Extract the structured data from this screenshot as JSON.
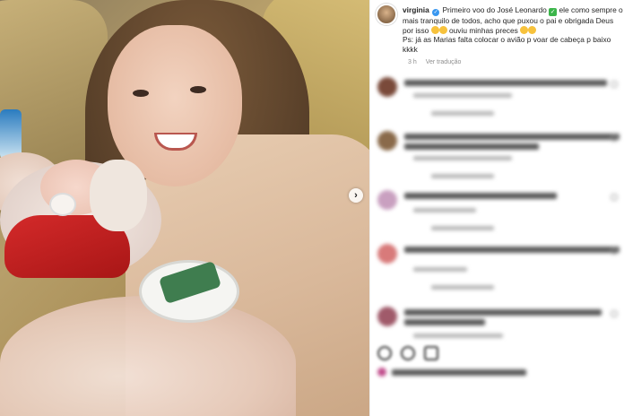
{
  "post": {
    "username": "virginia",
    "verified_icon": "verified-badge-icon",
    "caption_part1": "Primeiro voo do José Leonardo",
    "caption_part2": "ele como sempre o mais tranquilo de todos, acho que puxou o pai e obrigada Deus por isso",
    "caption_part3": "ouviu minhas preces",
    "caption_part4": "Ps: já as Marias falta colocar o avião p voar de cabeça p baixo kkkk",
    "time_ago": "3 h",
    "translate_link": "Ver tradução"
  },
  "carousel": {
    "next_icon": "chevron-right-icon",
    "next_label": "›"
  },
  "colors": {
    "accent": "#3897f0",
    "check": "#3bb54a",
    "text": "#262626",
    "muted": "#8e8e8e"
  },
  "blurred_comments_count": 5
}
